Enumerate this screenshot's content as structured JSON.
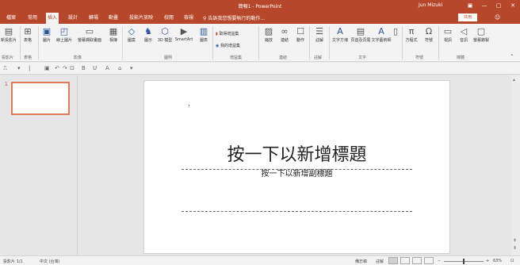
{
  "titlebar": {
    "title": "簡報1 - PowerPoint",
    "user": "Jun Mizuki",
    "minimize": "—",
    "restore": "▢",
    "close": "✕",
    "ribbon_toggle": "▣"
  },
  "tabs": [
    {
      "label": "檔案"
    },
    {
      "label": "常用"
    },
    {
      "label": "插入"
    },
    {
      "label": "設計"
    },
    {
      "label": "轉場"
    },
    {
      "label": "動畫"
    },
    {
      "label": "投影片放映"
    },
    {
      "label": "校閱"
    },
    {
      "label": "檢視"
    }
  ],
  "search": "告訴我您想要執行的動作...",
  "share": "共用",
  "ribbon": {
    "buttons": {
      "new_slide": "新投影片",
      "table": "表格",
      "pictures": "圖片",
      "online_pictures": "線上圖片",
      "screenshot": "螢幕擷取畫面",
      "photo_album": "相簿",
      "shapes": "圖案",
      "icons": "圖示",
      "models_3d": "3D 模型",
      "smartart": "SmartArt",
      "chart": "圖表",
      "zoom": "縮放",
      "link": "連結",
      "action": "動作",
      "comment": "註解",
      "textbox": "文字方塊",
      "header_footer": "頁首及頁尾",
      "wordart": "文字藝術師",
      "equation": "方程式",
      "symbol": "符號",
      "video": "視訊",
      "audio": "音訊",
      "screen_recording": "螢幕錄製"
    },
    "small": {
      "store": "取得增益集",
      "my_addins": "我的增益集"
    },
    "groups": {
      "slides": "投影片",
      "tables": "表格",
      "images": "影像",
      "illustrations": "圖例",
      "addins": "增益集",
      "links": "連結",
      "comments": "註解",
      "text": "文字",
      "symbols": "符號",
      "media": "媒體"
    }
  },
  "slides_pane": {
    "slide_number": "1"
  },
  "slide": {
    "title_placeholder": "按一下以新增標題",
    "subtitle_placeholder": "按一下以新增副標題"
  },
  "status": {
    "slide_info": "投影片 1/1",
    "language": "中文 (台灣)",
    "notes": "備忘稿",
    "comments": "註解",
    "zoom": "63%"
  },
  "colors": {
    "accent": "#b7472a",
    "ribbon_bg": "#f3f3f3",
    "thumb_border": "#e07b53"
  }
}
